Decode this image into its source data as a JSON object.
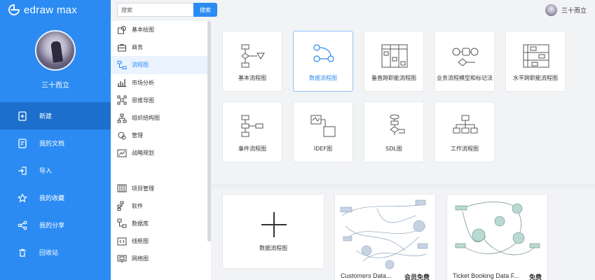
{
  "app": {
    "name": "edraw max",
    "brand_color": "#2b8bf2",
    "active_color": "#1c6fcc"
  },
  "user": {
    "name": "三十而立"
  },
  "search": {
    "placeholder": "搜索",
    "button": "搜索"
  },
  "nav": [
    {
      "label": "新建",
      "icon": "new-file-icon",
      "active": true
    },
    {
      "label": "我的文档",
      "icon": "document-icon"
    },
    {
      "label": "导入",
      "icon": "import-icon"
    },
    {
      "label": "我的收藏",
      "icon": "star-icon"
    },
    {
      "label": "我的分享",
      "icon": "share-icon"
    },
    {
      "label": "回收站",
      "icon": "recycle-bin-icon"
    }
  ],
  "categories": [
    {
      "label": "基本绘图",
      "icon": "basic-shapes-icon"
    },
    {
      "label": "商务",
      "icon": "briefcase-icon"
    },
    {
      "label": "流程图",
      "icon": "flowchart-icon",
      "active": true
    },
    {
      "label": "市场分析",
      "icon": "bar-chart-icon"
    },
    {
      "label": "思维导图",
      "icon": "mindmap-icon"
    },
    {
      "label": "组织结构图",
      "icon": "org-chart-icon"
    },
    {
      "label": "管理",
      "icon": "management-icon"
    },
    {
      "label": "战略规划",
      "icon": "strategy-icon"
    },
    {
      "label": "项目管理",
      "icon": "project-icon"
    },
    {
      "label": "软件",
      "icon": "software-icon"
    },
    {
      "label": "数据库",
      "icon": "database-icon"
    },
    {
      "label": "线框图",
      "icon": "wireframe-icon"
    },
    {
      "label": "网络图",
      "icon": "network-icon"
    }
  ],
  "types": [
    {
      "label": "基本流程图",
      "icon": "basic-flowchart-icon"
    },
    {
      "label": "数据流程图",
      "icon": "data-flow-icon",
      "selected": true
    },
    {
      "label": "垂直跨职能流程图",
      "icon": "vertical-swimlane-icon"
    },
    {
      "label": "业务流程模型和标记法",
      "icon": "bpmn-icon"
    },
    {
      "label": "水平跨职能流程图",
      "icon": "horizontal-swimlane-icon"
    },
    {
      "label": "事件流程图",
      "icon": "event-flow-icon"
    },
    {
      "label": "IDEF图",
      "icon": "idef-icon"
    },
    {
      "label": "SDL图",
      "icon": "sdl-icon"
    },
    {
      "label": "工作流程图",
      "icon": "workflow-icon"
    }
  ],
  "templates": {
    "new_label": "数据流程图",
    "cards": [
      {
        "title": "Customers Data...",
        "badge": "会员免费"
      },
      {
        "title": "Ticket Booking Data F...",
        "badge": "免费"
      }
    ]
  }
}
